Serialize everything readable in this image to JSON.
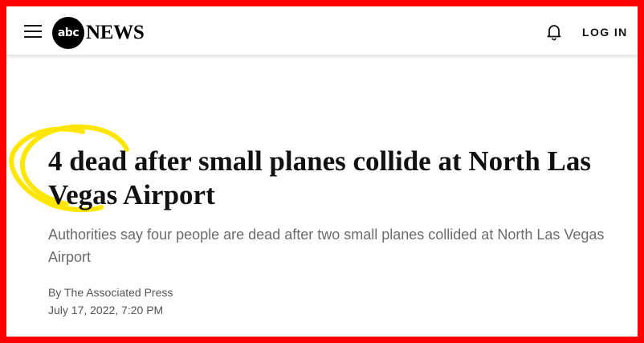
{
  "brand": {
    "logo_mark": "abc",
    "logo_word": "NEWS"
  },
  "header": {
    "login_label": "LOG IN",
    "menu_icon": "hamburger-icon",
    "bell_icon": "bell-icon"
  },
  "article": {
    "headline": "4 dead after small planes collide at North Las Vegas Airport",
    "dek": "Authorities say four people are dead after two small planes collided at North Las Vegas Airport",
    "byline": "By The Associated Press",
    "date": "July 17, 2022, 7:20 PM"
  },
  "colors": {
    "frame": "#ff0000",
    "highlight": "#ffe600",
    "text": "#111111",
    "dek": "#6b6b6b"
  }
}
